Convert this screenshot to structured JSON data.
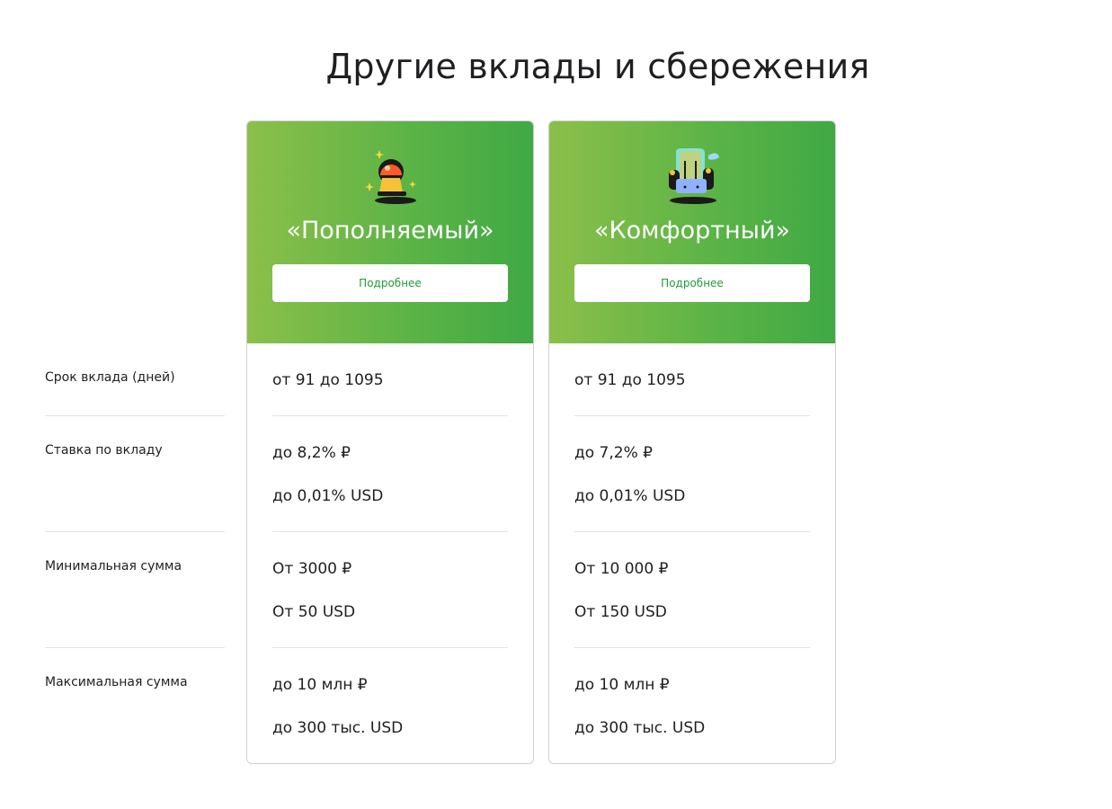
{
  "page": {
    "title": "Другие вклады и сбережения"
  },
  "rows": [
    "Срок вклада (дней)",
    "Ставка по вкладу",
    "Минимальная сумма",
    "Максимальная сумма"
  ],
  "cards": [
    {
      "name": "«Пополняемый»",
      "button": "Подробнее",
      "icon": "bell-icon",
      "term": "от 91 до 1095",
      "rate_rub": "до 8,2% ₽",
      "rate_usd": "до 0,01% USD",
      "min_rub": "От 3000 ₽",
      "min_usd": "От 50 USD",
      "max_rub": "до 10 млн ₽",
      "max_usd": "до 300 тыс. USD"
    },
    {
      "name": "«Комфортный»",
      "button": "Подробнее",
      "icon": "armchair-icon",
      "term": "от 91 до 1095",
      "rate_rub": "до 7,2% ₽",
      "rate_usd": "до 0,01% USD",
      "min_rub": "От 10 000 ₽",
      "min_usd": "От 150 USD",
      "max_rub": "до 10 млн ₽",
      "max_usd": "до 300 тыс. USD"
    }
  ],
  "colors": {
    "header_gradient_start": "#8cbf4a",
    "header_gradient_end": "#3fa944",
    "button_text": "#1f9c3a"
  }
}
